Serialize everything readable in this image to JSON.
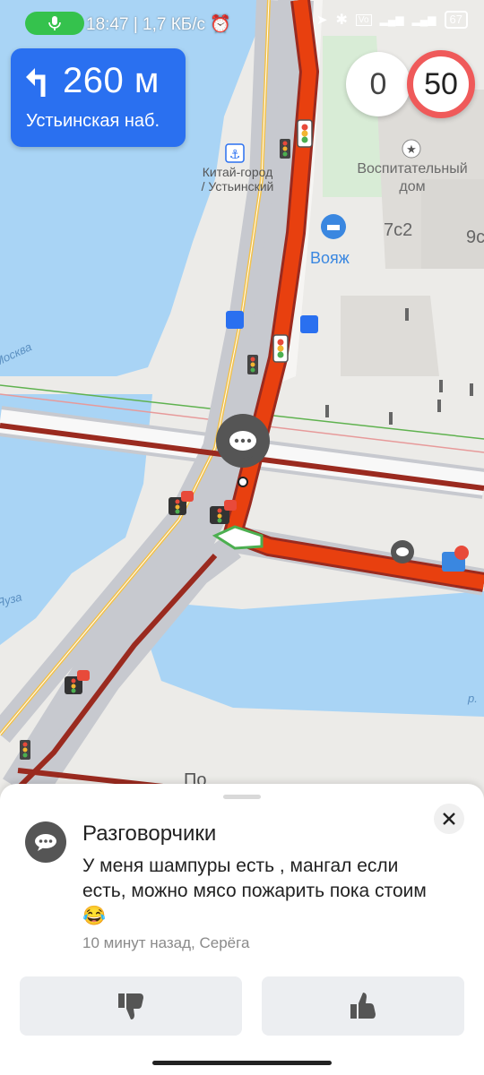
{
  "status_bar": {
    "time": "18:47",
    "speed": "1,7 КБ/с",
    "battery": "67"
  },
  "navigation": {
    "distance": "260 м",
    "street": "Устьинская наб."
  },
  "speed": {
    "current": "0",
    "limit": "50"
  },
  "map_labels": {
    "station": "Китай-город / Устьинский",
    "station_line1": "Китай-город",
    "station_line2": "/ Устьинский",
    "landmark_line1": "Воспитательный",
    "landmark_line2": "дом",
    "building_7c2": "7с2",
    "building_9c": "9с",
    "poi": "Вояж",
    "river_moskva": "Москва",
    "river_yauza": "Яуза",
    "river_r": "р.",
    "street_partial": "По"
  },
  "colors": {
    "route": "#e8400f",
    "traffic_jam": "#9a2a1f",
    "water": "#a9d4f5",
    "nav_card": "#2a70f0",
    "speed_limit_ring": "#ef5a5a"
  },
  "comment_sheet": {
    "title": "Разговорчики",
    "message": "У меня шампуры есть , мангал если есть, можно мясо пожарить пока стоим 😂",
    "meta": "10 минут назад, Серёга",
    "dislike_icon": "thumbs-down-icon",
    "like_icon": "thumbs-up-icon"
  }
}
